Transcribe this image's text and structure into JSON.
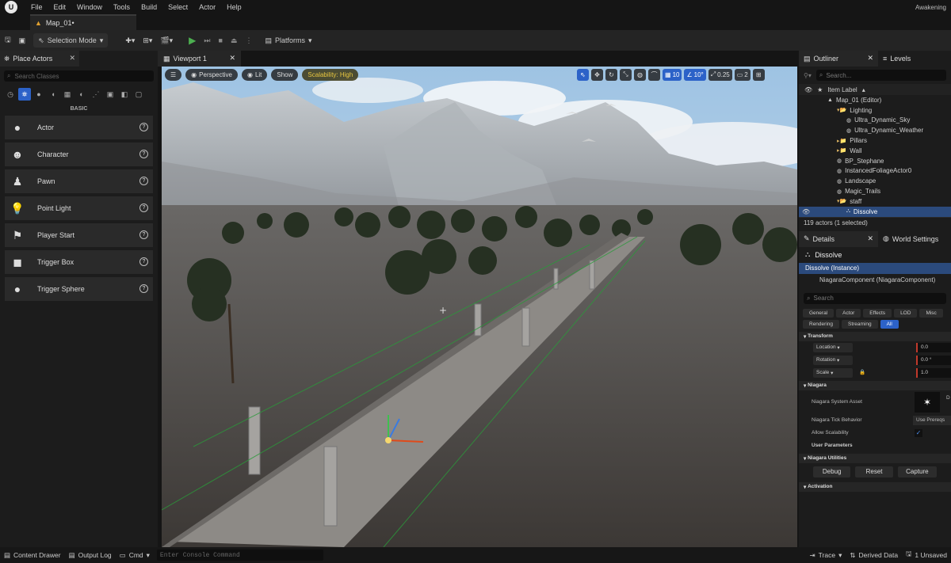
{
  "menubar": {
    "items": [
      "File",
      "Edit",
      "Window",
      "Tools",
      "Build",
      "Select",
      "Actor",
      "Help"
    ],
    "project": "Awakening"
  },
  "tabs": {
    "map": "Map_01•"
  },
  "toolbar": {
    "selection_mode": "Selection Mode",
    "platforms": "Platforms"
  },
  "place_actors": {
    "title": "Place Actors",
    "search_placeholder": "Search Classes",
    "category": "BASIC",
    "items": [
      {
        "label": "Actor",
        "icon": "sphere-icon"
      },
      {
        "label": "Character",
        "icon": "character-icon"
      },
      {
        "label": "Pawn",
        "icon": "pawn-icon"
      },
      {
        "label": "Point Light",
        "icon": "light-bulb-icon"
      },
      {
        "label": "Player Start",
        "icon": "flag-icon"
      },
      {
        "label": "Trigger Box",
        "icon": "cube-icon"
      },
      {
        "label": "Trigger Sphere",
        "icon": "sphere-icon"
      }
    ]
  },
  "viewport": {
    "tab": "Viewport 1",
    "perspective": "Perspective",
    "lit": "Lit",
    "show": "Show",
    "scalability": "Scalability: High",
    "grid_snap": "10",
    "rot_snap": "10°",
    "scale_snap": "0.25",
    "camera_speed": "2"
  },
  "outliner": {
    "title": "Outliner",
    "levels_tab": "Levels",
    "search_placeholder": "Search...",
    "column_header": "Item Label",
    "rows": [
      {
        "label": "Map_01 (Editor)",
        "indent": 0,
        "type": "map"
      },
      {
        "label": "Lighting",
        "indent": 1,
        "type": "folder-open"
      },
      {
        "label": "Ultra_Dynamic_Sky",
        "indent": 2,
        "type": "actor"
      },
      {
        "label": "Ultra_Dynamic_Weather",
        "indent": 2,
        "type": "actor"
      },
      {
        "label": "Pillars",
        "indent": 1,
        "type": "folder"
      },
      {
        "label": "Wall",
        "indent": 1,
        "type": "folder"
      },
      {
        "label": "BP_Stephane",
        "indent": 1,
        "type": "actor"
      },
      {
        "label": "InstancedFoliageActor0",
        "indent": 1,
        "type": "actor"
      },
      {
        "label": "Landscape",
        "indent": 1,
        "type": "actor"
      },
      {
        "label": "Magic_Trails",
        "indent": 1,
        "type": "actor"
      },
      {
        "label": "staff",
        "indent": 1,
        "type": "folder-open"
      },
      {
        "label": "Dissolve",
        "indent": 2,
        "type": "niagara",
        "selected": true
      }
    ],
    "count": "119 actors (1 selected)"
  },
  "details": {
    "title": "Details",
    "world_settings": "World Settings",
    "actor_name": "Dissolve",
    "instance": "Dissolve (Instance)",
    "component": "NiagaraComponent (NiagaraComponent)",
    "search_placeholder": "Search",
    "filters": [
      "General",
      "Actor",
      "Effects",
      "LOD",
      "Misc",
      "Rendering",
      "Streaming",
      "All"
    ],
    "transform": {
      "section": "Transform",
      "location": "Location",
      "rotation": "Rotation",
      "scale": "Scale",
      "location_val": "0.0",
      "rotation_val": "0.0 °",
      "scale_val": "1.0"
    },
    "niagara": {
      "section": "Niagara",
      "system_asset": "Niagara System Asset",
      "asset_val": "D",
      "tick_behavior": "Niagara Tick Behavior",
      "tick_val": "Use Prereqs",
      "allow_scalability": "Allow Scalability",
      "user_params": "User Parameters"
    },
    "utilities": {
      "section": "Niagara Utilities",
      "debug": "Debug",
      "reset": "Reset",
      "capture": "Capture"
    },
    "activation": {
      "section": "Activation"
    }
  },
  "statusbar": {
    "content_drawer": "Content Drawer",
    "output_log": "Output Log",
    "cmd": "Cmd",
    "console_placeholder": "Enter Console Command",
    "trace": "Trace",
    "derived_data": "Derived Data",
    "unsaved": "1 Unsaved"
  }
}
